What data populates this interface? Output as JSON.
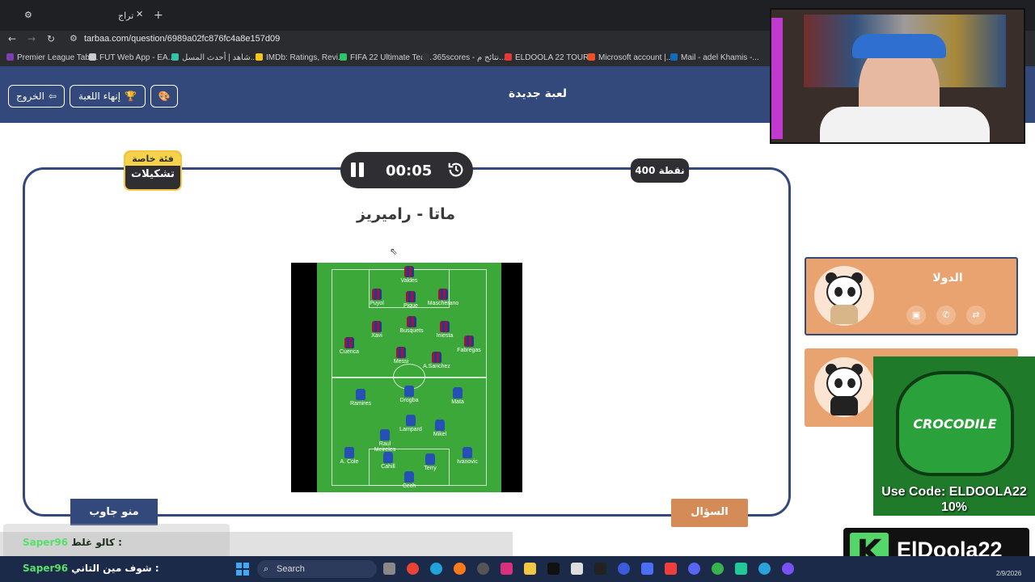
{
  "browser": {
    "tab_title": "تراج",
    "url": "tarbaa.com/question/6989a02fc876fc4a8e157d09",
    "bookmarks": [
      {
        "label": "Premier League Tabl...",
        "color": "#7b3fb0"
      },
      {
        "label": "FUT Web App - EA...",
        "color": "#cccccc"
      },
      {
        "label": "شاهد | أحدث المسل...",
        "color": "#35c2a6"
      },
      {
        "label": "IMDb: Ratings, Revi...",
        "color": "#f5c518"
      },
      {
        "label": "FIFA 22 Ultimate Tea...",
        "color": "#2cc36b"
      },
      {
        "label": "365scores - نتائج م...",
        "color": "#333333"
      },
      {
        "label": "ELDOOLA 22 TOUR...",
        "color": "#e53935"
      },
      {
        "label": "Microsoft account |...",
        "color": "#f25022"
      },
      {
        "label": "Mail - adel Khamis -...",
        "color": "#0f6cbd"
      }
    ]
  },
  "header": {
    "title": "لعبة جديدة",
    "end_game_label": "إنهاء اللعبة",
    "exit_label": "الخروج"
  },
  "board": {
    "category_label": "فئة خاصة",
    "category_name": "تشكيلات",
    "timer": "00:05",
    "points": "400 نقطة",
    "question": "ماتا - راميريز",
    "who_answered_label": "منو جاوب",
    "question_button_label": "السؤال"
  },
  "formation": {
    "team_a_players": [
      "Valdes",
      "Puyol",
      "Pique",
      "Mascherano",
      "Xavi",
      "Busquets",
      "Iniesta",
      "Cuenca",
      "Fabregas",
      "Messi",
      "A.Sanchez"
    ],
    "team_b_players": [
      "Drogba",
      "Ramires",
      "Mata",
      "Lampard",
      "Raul Meireles",
      "Mikel",
      "A. Cole",
      "Cahill",
      "Terry",
      "Ivanovic",
      "Cech"
    ],
    "team_a_color": "#a3123a",
    "team_b_color": "#2650b3"
  },
  "teams": [
    {
      "name": "الدولا",
      "lifelines": [
        "camera-icon",
        "phone-icon",
        "swap-icon"
      ]
    },
    {
      "name": "",
      "lifelines": []
    }
  ],
  "overlay": {
    "sponsor_text": "CROCODILE",
    "sponsor_code": "Use Code: ELDOOLA22",
    "sponsor_discount": "10%",
    "brand_letter": "K",
    "brand_name": "ElDoola22"
  },
  "chat": [
    {
      "user": "Saper96",
      "message": "كالو غلط :"
    },
    {
      "user": "Saper96",
      "message": "شوف مين التاني :"
    }
  ],
  "taskbar": {
    "search_placeholder": "Search",
    "date": "2/9/2026"
  },
  "colors": {
    "primary": "#33497b",
    "accent": "#d48b57",
    "team_card": "#e9a371",
    "dark_chip": "#2e2e33"
  }
}
